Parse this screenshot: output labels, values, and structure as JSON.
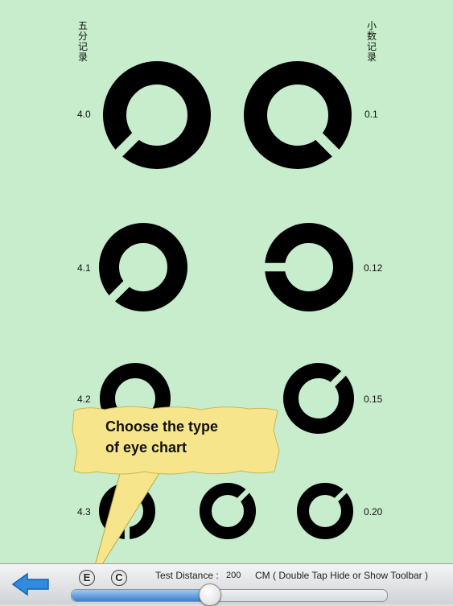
{
  "chart": {
    "left_heading": "五分记录",
    "right_heading": "小数记录",
    "rows": [
      {
        "left_value": "4.0",
        "right_value": "0.1"
      },
      {
        "left_value": "4.1",
        "right_value": "0.12"
      },
      {
        "left_value": "4.2",
        "right_value": "0.15"
      },
      {
        "left_value": "4.3",
        "right_value": "0.20"
      }
    ]
  },
  "tooltip": {
    "line1": "Choose the type",
    "line2": "of eye chart",
    "color": "#f6e58a"
  },
  "toolbar": {
    "back_icon": "left-arrow-icon",
    "e_chart_label": "E",
    "c_chart_label": "C",
    "distance_label": "Test Distance :",
    "distance_value": "200",
    "distance_unit": "CM ( Double Tap Hide or Show Toolbar )",
    "slider_fraction": 0.44
  },
  "colors": {
    "background": "#c7edcd",
    "accent": "#2f8be0",
    "ring": "#000000"
  }
}
